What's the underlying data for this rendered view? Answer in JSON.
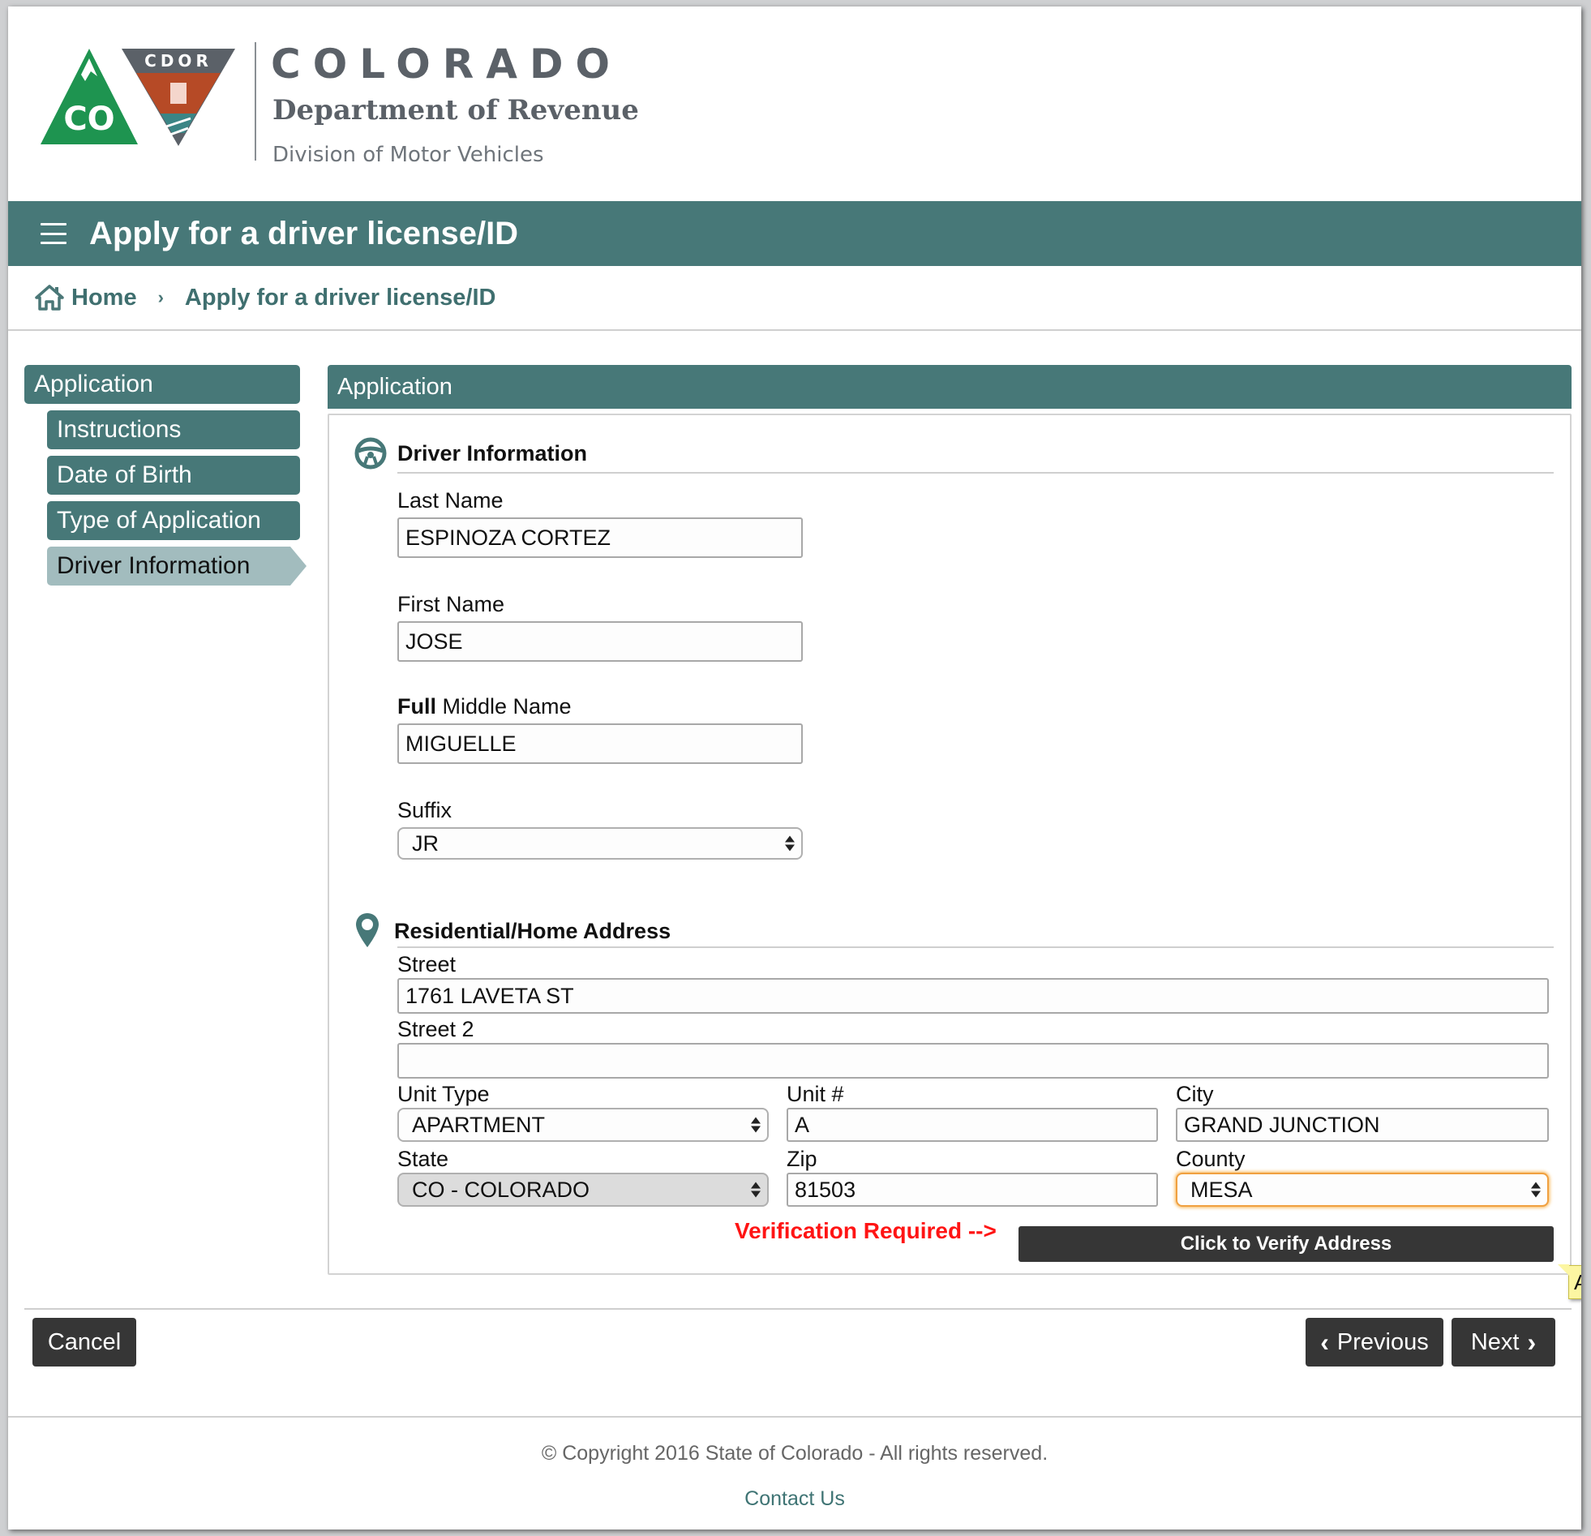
{
  "header": {
    "logo_left_text": "CO",
    "logo_right_text": "CDOR",
    "brand_title": "COLORADO",
    "brand_subtitle": "Department of Revenue",
    "brand_division": "Division of Motor Vehicles"
  },
  "titlebar": {
    "menu_icon": "hamburger-icon",
    "title": "Apply for a driver license/ID"
  },
  "breadcrumb": {
    "home_icon": "home-icon",
    "home": "Home",
    "separator": "›",
    "current": "Apply for a driver license/ID"
  },
  "sidebar": {
    "top": "Application",
    "items": [
      {
        "label": "Instructions",
        "active": false
      },
      {
        "label": "Date of Birth",
        "active": false
      },
      {
        "label": "Type of Application",
        "active": false
      },
      {
        "label": "Driver Information",
        "active": true
      }
    ]
  },
  "main": {
    "panel_title": "Application",
    "driver_section": {
      "icon": "steering-wheel-icon",
      "title": "Driver Information",
      "last_name_label": "Last Name",
      "last_name_value": "ESPINOZA CORTEZ",
      "first_name_label": "First Name",
      "first_name_value": "JOSE",
      "middle_label_bold": "Full",
      "middle_label_rest": " Middle Name",
      "middle_name_value": "MIGUELLE",
      "suffix_label": "Suffix",
      "suffix_value": "JR"
    },
    "address_section": {
      "icon": "map-pin-icon",
      "title": "Residential/Home Address",
      "street_label": "Street",
      "street_value": "1761 LAVETA ST",
      "street2_label": "Street 2",
      "street2_value": "",
      "unit_type_label": "Unit Type",
      "unit_type_value": "APARTMENT",
      "unit_no_label": "Unit #",
      "unit_no_value": "A",
      "city_label": "City",
      "city_value": "GRAND JUNCTION",
      "state_label": "State",
      "state_value": "CO - COLORADO",
      "zip_label": "Zip",
      "zip_value": "81503",
      "county_label": "County",
      "county_value": "MESA"
    },
    "verification_text": "Verification Required -->",
    "verify_button": "Click to Verify Address",
    "tooltip_text": "Ad"
  },
  "actions": {
    "cancel": "Cancel",
    "previous": "Previous",
    "next": "Next"
  },
  "footer": {
    "copyright": "© Copyright 2016 State of Colorado - All rights reserved.",
    "contact": "Contact Us"
  },
  "colors": {
    "brand_teal": "#477878",
    "active_step": "#a2bcbe",
    "dark_button": "#363636",
    "warning_red": "#ff1414",
    "focus_orange": "#f0a040"
  }
}
